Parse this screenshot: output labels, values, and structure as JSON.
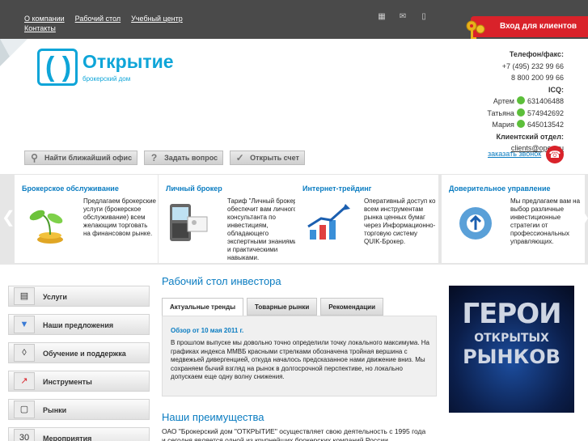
{
  "topnav": {
    "items": [
      "О компании",
      "Рабочий стол",
      "Учебный центр",
      "Контакты"
    ]
  },
  "top_icons": [
    "sitemap-icon",
    "mail-icon",
    "mobile-icon"
  ],
  "login_button": "Вход для клиентов",
  "logo": {
    "title": "Открытие",
    "subtitle": "брокерский дом"
  },
  "contacts": {
    "phone_label": "Телефон/факс:",
    "phone1": "+7 (495) 232 99 66",
    "phone2": "8 800 200 99 66",
    "icq_label": "ICQ:",
    "icq": [
      {
        "name": "Артем",
        "number": "631406488"
      },
      {
        "name": "Татьяна",
        "number": "574942692"
      },
      {
        "name": "Мария",
        "number": "645013542"
      }
    ],
    "dept_label": "Клиентский отдел:",
    "email": "clients@open.ru",
    "callback": "заказать звонок"
  },
  "actions": [
    "Найти ближайший офис",
    "Задать вопрос",
    "Открыть счет"
  ],
  "services": [
    {
      "title": "Брокерское обслуживание",
      "text": "Предлагаем брокерские услуги (брокерское обслуживание) всем желающим торговать на финансовом рынке."
    },
    {
      "title": "Личный брокер",
      "text": "Тариф \"Личный брокер\" обеспечит вам личного консультанта по инвестициям, обладающего экспертными знаниями и практическими навыками."
    },
    {
      "title": "Интернет-трейдинг",
      "text": "Оперативный доступ ко всем инструментам рынка ценных бумаг через Информационно-торговую систему QUIK-Брокер."
    },
    {
      "title": "Доверительное управление",
      "text": "Мы предлагаем вам на выбор различные инвестиционные стратегии от профессиональных управляющих."
    }
  ],
  "menu": [
    "Услуги",
    "Наши предложения",
    "Обучение и поддержка",
    "Инструменты",
    "Рынки",
    "Мероприятия"
  ],
  "menu_icons": [
    "briefcase-icon",
    "tie-icon",
    "lamp-icon",
    "chart-icon",
    "monitor-icon",
    "calendar-icon"
  ],
  "calendar_day": "30",
  "main": {
    "title": "Рабочий стол инвестора",
    "tabs": [
      "Актуальные тренды",
      "Товарные рынки",
      "Рекомендации"
    ],
    "review_date": "Обзор от 10 мая 2011 г.",
    "review_text": "В прошлом выпуске мы довольно точно определили точку локального максимума. На графиках индекса ММВБ красными стрелками обозначена тройная вершина с медвежьей дивергенцией, откуда началось предсказанное нами движение вниз. Мы сохраняем бычий взгляд на рынок в долгосрочной перспективе, но локально допускаем еще одну волну снижения.",
    "adv_title": "Наши преимущества",
    "adv_text": "ОАО \"Брокерский дом \"ОТКРЫТИЕ\" осуществляет свою деятельность с 1995 года и сегодня является одной из крупнейших брокерских компаний России."
  },
  "banner": {
    "line1": "ГЕРОИ",
    "line2": "ОТКРЫТЫХ",
    "line3": "РЫНКОВ"
  },
  "colors": {
    "accent": "#0a7cc1",
    "brand": "#0ea5d8",
    "login": "#d9222a",
    "topbar": "#4a4a4a"
  }
}
